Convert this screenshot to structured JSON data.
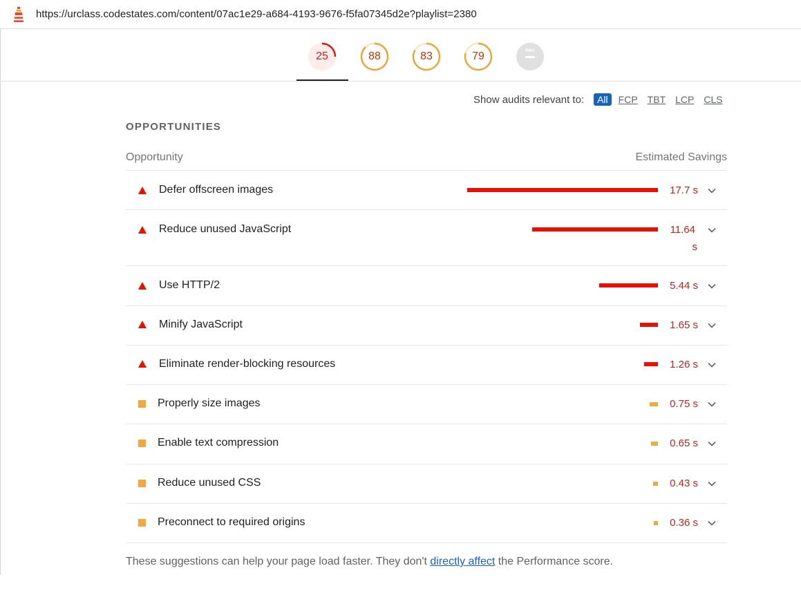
{
  "address_bar": {
    "url": "https://urclass.codestates.com/content/07ac1e29-a684-4193-9676-f5fa07345d2e?playlist=2380"
  },
  "gauges": [
    {
      "label": "25",
      "score": 0.25,
      "color": "#eb0f00",
      "bg": "#fdecea"
    },
    {
      "label": "88",
      "score": 0.88,
      "color": "#f0a232",
      "bg": "#ffffff"
    },
    {
      "label": "83",
      "score": 0.83,
      "color": "#f0a232",
      "bg": "#ffffff"
    },
    {
      "label": "79",
      "score": 0.79,
      "color": "#f0a232",
      "bg": "#ffffff"
    },
    {
      "label": "PWA",
      "score": null,
      "color": "#bdbdbd",
      "bg": "#e0e0e0"
    }
  ],
  "filter": {
    "label": "Show audits relevant to:",
    "chips": [
      "All",
      "FCP",
      "TBT",
      "LCP",
      "CLS"
    ],
    "active": "All"
  },
  "section": {
    "title": "OPPORTUNITIES",
    "col_left": "Opportunity",
    "col_right": "Estimated Savings"
  },
  "opportunities": [
    {
      "title": "Defer offscreen images",
      "savings": "17.7 s",
      "value": 17.7,
      "severity": "fail"
    },
    {
      "title": "Reduce unused JavaScript",
      "savings_line1": "11.64",
      "savings_line2": "s",
      "savings": "11.64 s",
      "value": 11.64,
      "severity": "fail"
    },
    {
      "title": "Use HTTP/2",
      "savings": "5.44 s",
      "value": 5.44,
      "severity": "fail"
    },
    {
      "title": "Minify JavaScript",
      "savings": "1.65 s",
      "value": 1.65,
      "severity": "fail"
    },
    {
      "title": "Eliminate render-blocking resources",
      "savings": "1.26 s",
      "value": 1.26,
      "severity": "fail"
    },
    {
      "title": "Properly size images",
      "savings": "0.75 s",
      "value": 0.75,
      "severity": "average"
    },
    {
      "title": "Enable text compression",
      "savings": "0.65 s",
      "value": 0.65,
      "severity": "average"
    },
    {
      "title": "Reduce unused CSS",
      "savings": "0.43 s",
      "value": 0.43,
      "severity": "average"
    },
    {
      "title": "Preconnect to required origins",
      "savings": "0.36 s",
      "value": 0.36,
      "severity": "average"
    }
  ],
  "colors": {
    "fail": "#eb0f00",
    "average": "#f4a83c",
    "savings_text": "#c5221f",
    "link": "#1a5fcf"
  },
  "icons": {
    "logo": "lighthouse-icon",
    "fail": "red-triangle-icon",
    "average": "orange-square-icon",
    "expand": "chevron-down-icon"
  },
  "footer": {
    "before": "These suggestions can help your page load faster. They don't ",
    "link": "directly affect",
    "after": " the Performance score."
  }
}
